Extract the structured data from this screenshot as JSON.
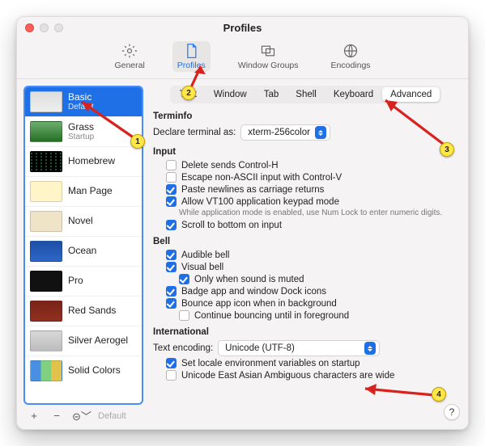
{
  "window": {
    "title": "Profiles"
  },
  "toolbar": {
    "items": [
      {
        "label": "General"
      },
      {
        "label": "Profiles"
      },
      {
        "label": "Window Groups"
      },
      {
        "label": "Encodings"
      }
    ]
  },
  "sidebar": {
    "profiles": [
      {
        "name": "Basic",
        "sub": "Default"
      },
      {
        "name": "Grass",
        "sub": "Startup"
      },
      {
        "name": "Homebrew",
        "sub": ""
      },
      {
        "name": "Man Page",
        "sub": ""
      },
      {
        "name": "Novel",
        "sub": ""
      },
      {
        "name": "Ocean",
        "sub": ""
      },
      {
        "name": "Pro",
        "sub": ""
      },
      {
        "name": "Red Sands",
        "sub": ""
      },
      {
        "name": "Silver Aerogel",
        "sub": ""
      },
      {
        "name": "Solid Colors",
        "sub": ""
      }
    ],
    "footer_default": "Default"
  },
  "tabs": {
    "items": [
      "Text",
      "Window",
      "Tab",
      "Shell",
      "Keyboard",
      "Advanced"
    ]
  },
  "terminfo": {
    "heading": "Terminfo",
    "declare_label": "Declare terminal as:",
    "declare_value": "xterm-256color"
  },
  "input": {
    "heading": "Input",
    "delete_ctrl_h": "Delete sends Control-H",
    "escape_nonascii": "Escape non-ASCII input with Control-V",
    "paste_newlines": "Paste newlines as carriage returns",
    "vt100_keypad": "Allow VT100 application keypad mode",
    "vt100_note": "While application mode is enabled, use Num Lock to enter numeric digits.",
    "scroll_bottom": "Scroll to bottom on input"
  },
  "bell": {
    "heading": "Bell",
    "audible": "Audible bell",
    "visual": "Visual bell",
    "only_muted": "Only when sound is muted",
    "badge_dock": "Badge app and window Dock icons",
    "bounce_bg": "Bounce app icon when in background",
    "continue_bounce": "Continue bouncing until in foreground"
  },
  "intl": {
    "heading": "International",
    "encoding_label": "Text encoding:",
    "encoding_value": "Unicode (UTF-8)",
    "set_locale": "Set locale environment variables on startup",
    "east_asian": "Unicode East Asian Ambiguous characters are wide"
  },
  "help": "?",
  "annotations": {
    "1": "1",
    "2": "2",
    "3": "3",
    "4": "4"
  }
}
